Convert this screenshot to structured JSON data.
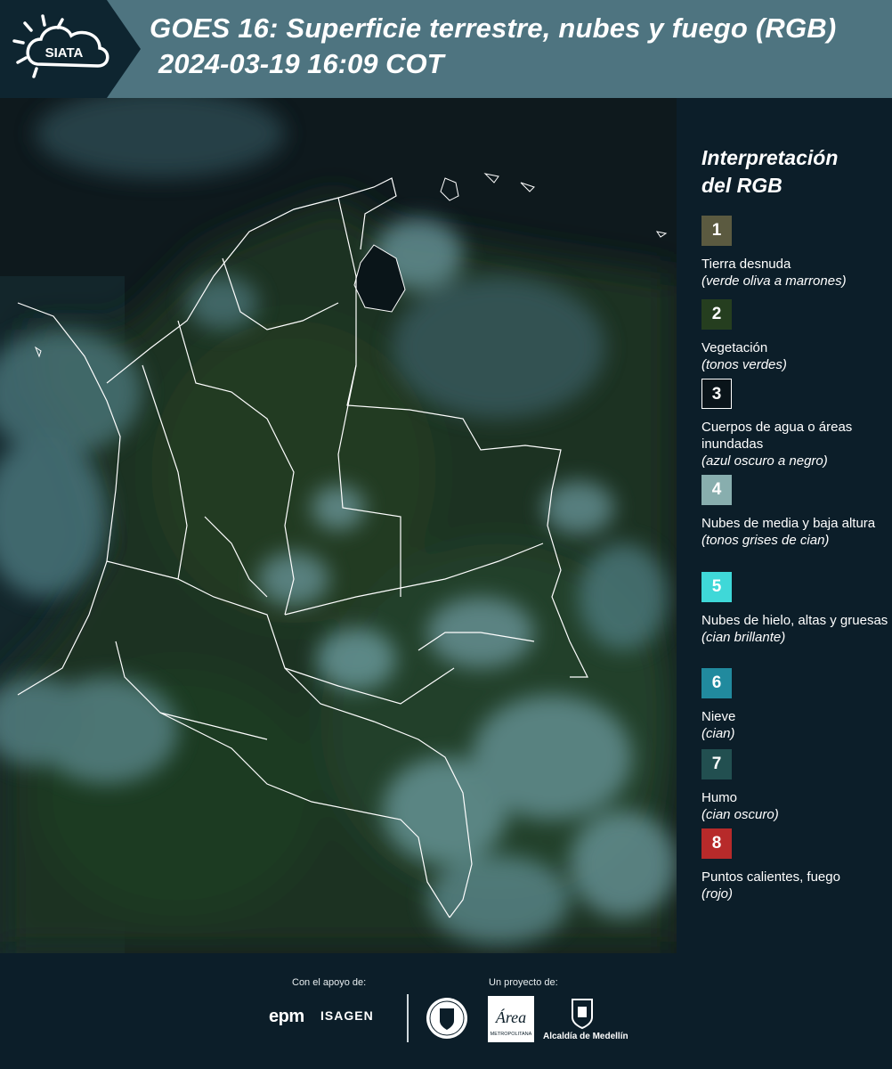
{
  "header": {
    "logo_text": "SIATA",
    "title": "GOES 16: Superficie terrestre, nubes y fuego (RGB)",
    "datetime": "2024-03-19 16:09 COT"
  },
  "legend": {
    "title_line1": "Interpretación",
    "title_line2": "del RGB",
    "items": [
      {
        "number": "1",
        "color": "#5b5a40",
        "label": "Tierra desnuda",
        "desc": "(verde oliva a marrones)"
      },
      {
        "number": "2",
        "color": "#253e1f",
        "label": "Vegetación",
        "desc": "(tonos verdes)"
      },
      {
        "number": "3",
        "color": "#0a141a",
        "label": "Cuerpos de agua o áreas inundadas",
        "desc": "(azul oscuro a negro)"
      },
      {
        "number": "4",
        "color": "#88aeae",
        "label": "Nubes de media y baja altura",
        "desc": "(tonos grises de cian)"
      },
      {
        "number": "5",
        "color": "#3fd8d8",
        "label": "Nubes de hielo, altas y gruesas",
        "desc": "(cian brillante)"
      },
      {
        "number": "6",
        "color": "#218a9e",
        "label": "Nieve",
        "desc": "(cian)"
      },
      {
        "number": "7",
        "color": "#224f50",
        "label": "Humo",
        "desc": "(cian oscuro)"
      },
      {
        "number": "8",
        "color": "#b72a2a",
        "label": "Puntos calientes, fuego",
        "desc": "(rojo)"
      }
    ]
  },
  "footer": {
    "support_label": "Con el apoyo de:",
    "project_label": "Un proyecto de:",
    "epm": "epm",
    "isagen": "ISAGEN",
    "area_logo_text": "Área",
    "area_logo_subtext": "METROPOLITANA",
    "alcaldia": "Alcaldía de Medellín"
  }
}
